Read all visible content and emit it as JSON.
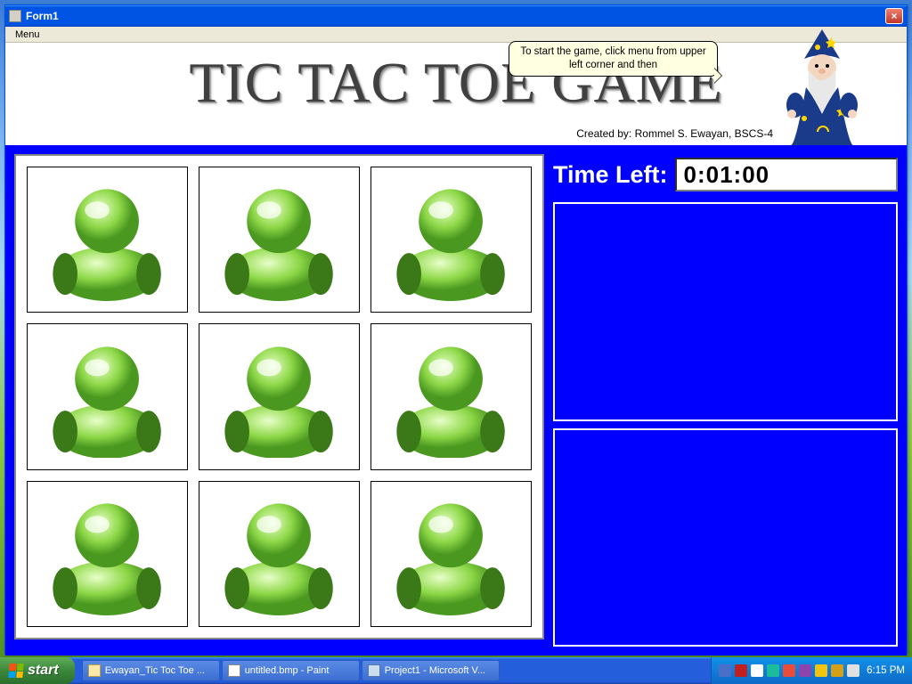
{
  "window": {
    "title": "Form1",
    "close_label": "×"
  },
  "menubar": {
    "menu": "Menu"
  },
  "header": {
    "title": "TIC TAC TOE GAME",
    "credit": "Created by: Rommel S. Ewayan, BSCS-4"
  },
  "tooltip": {
    "text": "To start the game, click menu from upper left corner and then"
  },
  "timer": {
    "label": "Time Left:",
    "value": "0:01:00"
  },
  "grid": {
    "cells": [
      "",
      "",
      "",
      "",
      "",
      "",
      "",
      "",
      ""
    ]
  },
  "taskbar": {
    "start": "start",
    "tasks": [
      {
        "label": "Ewayan_Tic Toc Toe ..."
      },
      {
        "label": "untitled.bmp - Paint"
      },
      {
        "label": "Project1 - Microsoft V..."
      }
    ],
    "clock": "6:15 PM"
  },
  "tray_icons": [
    "#4a6fc8",
    "#c02020",
    "#ffffff",
    "#1abc9c",
    "#e74c3c",
    "#8e44ad",
    "#f1c40f",
    "#d4a017",
    "#e0e0e0"
  ]
}
